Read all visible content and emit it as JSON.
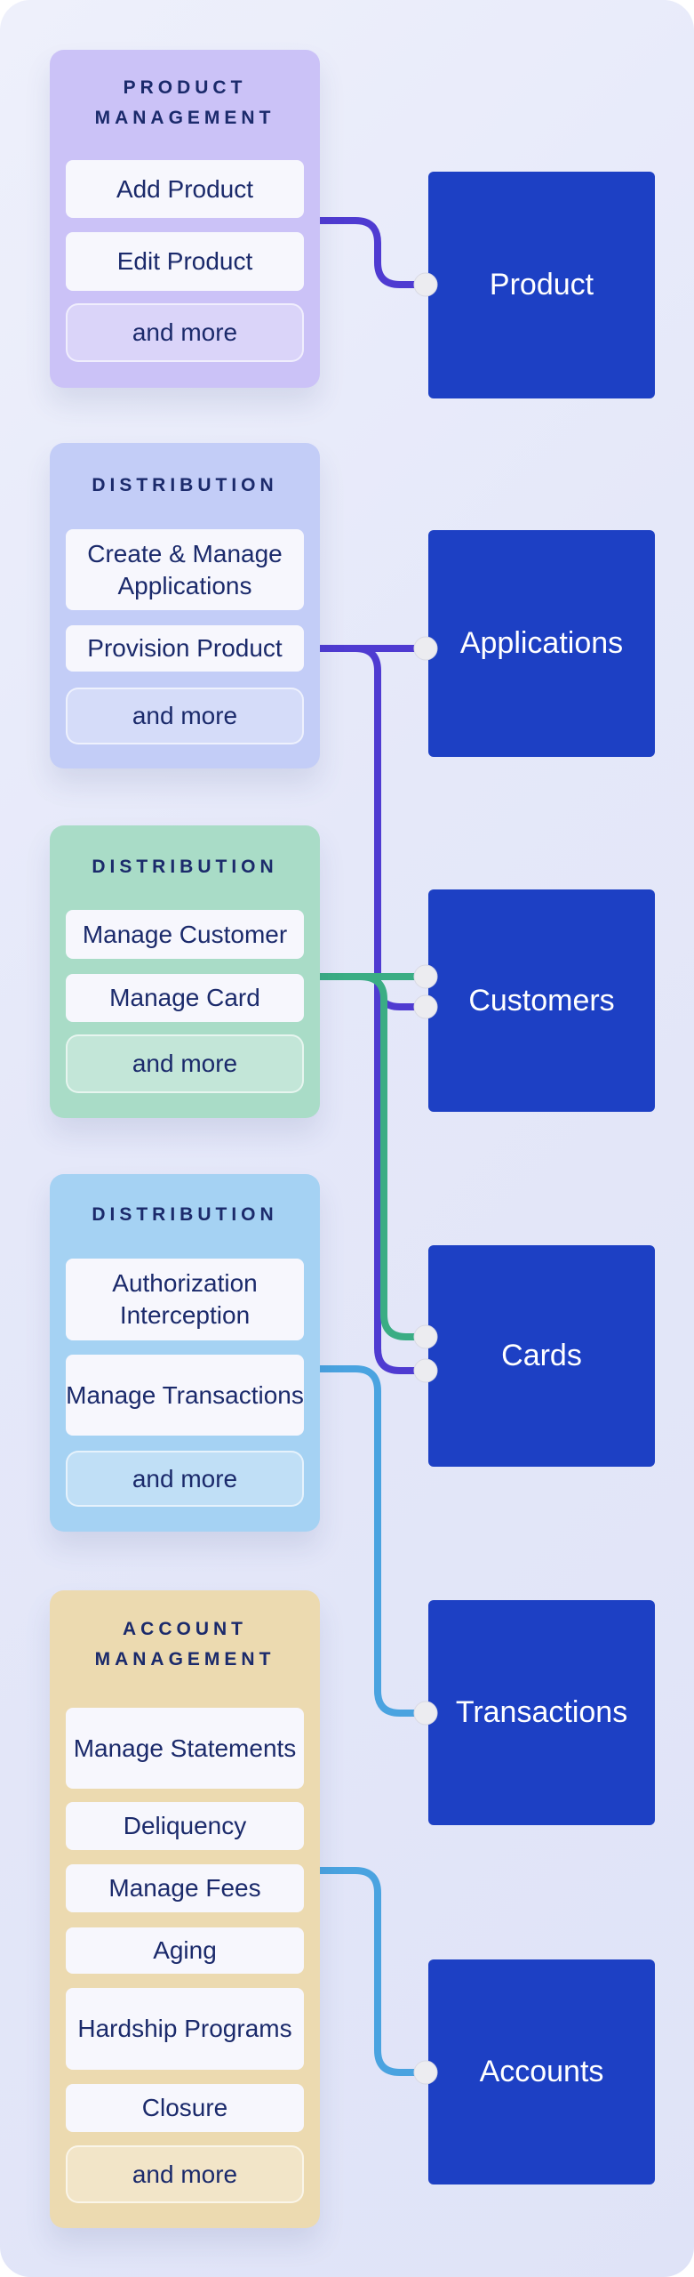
{
  "colors": {
    "target_box": "#1d40c4",
    "connector_purple": "#4f3bd1",
    "connector_green": "#3aad84",
    "connector_blue": "#4aa3e0",
    "text": "#1b2a6b"
  },
  "cards": [
    {
      "title": "Product Management",
      "color": "#cbc2f7",
      "items": [
        "Add Product",
        "Edit Product",
        "and more"
      ]
    },
    {
      "title": "Distribution",
      "color": "#c3cdf7",
      "items": [
        "Create & Manage Applications",
        "Provision Product",
        "and more"
      ]
    },
    {
      "title": "Distribution",
      "color": "#a9dcc7",
      "items": [
        "Manage Customer",
        "Manage Card",
        "and more"
      ]
    },
    {
      "title": "Distribution",
      "color": "#a5d2f3",
      "items": [
        "Authorization Interception",
        "Manage Transactions",
        "and more"
      ]
    },
    {
      "title": "Account Management",
      "color": "#ecdab0",
      "items": [
        "Manage Statements",
        "Deliquency",
        "Manage Fees",
        "Aging",
        "Hardship Programs",
        "Closure",
        "and more"
      ]
    }
  ],
  "targets": [
    "Product",
    "Applications",
    "Customers",
    "Cards",
    "Transactions",
    "Accounts"
  ]
}
